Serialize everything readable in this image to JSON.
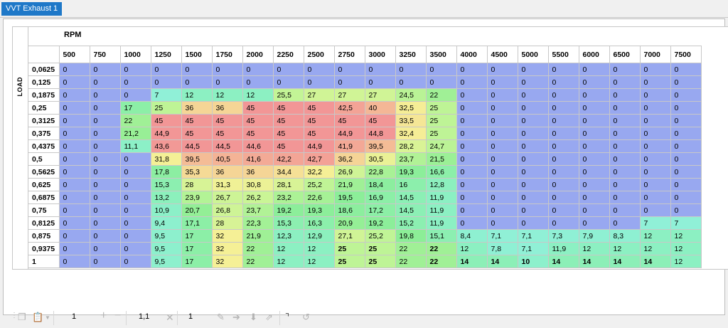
{
  "tab_title": "VVT Exhaust 1",
  "axis": {
    "x_label": "RPM",
    "y_label": "LOAD"
  },
  "rpm": [
    "500",
    "750",
    "1000",
    "1250",
    "1500",
    "1750",
    "2000",
    "2250",
    "2500",
    "2750",
    "3000",
    "3250",
    "3500",
    "4000",
    "4500",
    "5000",
    "5500",
    "6000",
    "6500",
    "7000",
    "7500"
  ],
  "rows": [
    {
      "load": "0,0625",
      "v": [
        "0",
        "0",
        "0",
        "0",
        "0",
        "0",
        "0",
        "0",
        "0",
        "0",
        "0",
        "0",
        "0",
        "0",
        "0",
        "0",
        "0",
        "0",
        "0",
        "0",
        "0"
      ]
    },
    {
      "load": "0,125",
      "v": [
        "0",
        "0",
        "0",
        "0",
        "0",
        "0",
        "0",
        "0",
        "0",
        "0",
        "0",
        "0",
        "0",
        "0",
        "0",
        "0",
        "0",
        "0",
        "0",
        "0",
        "0"
      ]
    },
    {
      "load": "0,1875",
      "v": [
        "0",
        "0",
        "0",
        "7",
        "12",
        "12",
        "12",
        "25,5",
        "27",
        "27",
        "27",
        "24,5",
        "22",
        "0",
        "0",
        "0",
        "0",
        "0",
        "0",
        "0",
        "0"
      ]
    },
    {
      "load": "0,25",
      "v": [
        "0",
        "0",
        "17",
        "25",
        "36",
        "36",
        "45",
        "45",
        "45",
        "42,5",
        "40",
        "32,5",
        "25",
        "0",
        "0",
        "0",
        "0",
        "0",
        "0",
        "0",
        "0"
      ]
    },
    {
      "load": "0,3125",
      "v": [
        "0",
        "0",
        "22",
        "45",
        "45",
        "45",
        "45",
        "45",
        "45",
        "45",
        "45",
        "33,5",
        "25",
        "0",
        "0",
        "0",
        "0",
        "0",
        "0",
        "0",
        "0"
      ]
    },
    {
      "load": "0,375",
      "v": [
        "0",
        "0",
        "21,2",
        "44,9",
        "45",
        "45",
        "45",
        "45",
        "45",
        "44,9",
        "44,8",
        "32,4",
        "25",
        "0",
        "0",
        "0",
        "0",
        "0",
        "0",
        "0",
        "0"
      ]
    },
    {
      "load": "0,4375",
      "v": [
        "0",
        "0",
        "11,1",
        "43,6",
        "44,5",
        "44,5",
        "44,6",
        "45",
        "44,9",
        "41,9",
        "39,5",
        "28,2",
        "24,7",
        "0",
        "0",
        "0",
        "0",
        "0",
        "0",
        "0",
        "0"
      ]
    },
    {
      "load": "0,5",
      "v": [
        "0",
        "0",
        "0",
        "31,8",
        "39,5",
        "40,5",
        "41,6",
        "42,2",
        "42,7",
        "36,2",
        "30,5",
        "23,7",
        "21,5",
        "0",
        "0",
        "0",
        "0",
        "0",
        "0",
        "0",
        "0"
      ]
    },
    {
      "load": "0,5625",
      "v": [
        "0",
        "0",
        "0",
        "17,8",
        "35,3",
        "36",
        "36",
        "34,4",
        "32,2",
        "26,9",
        "22,8",
        "19,3",
        "16,6",
        "0",
        "0",
        "0",
        "0",
        "0",
        "0",
        "0",
        "0"
      ]
    },
    {
      "load": "0,625",
      "v": [
        "0",
        "0",
        "0",
        "15,3",
        "28",
        "31,3",
        "30,8",
        "28,1",
        "25,2",
        "21,9",
        "18,4",
        "16",
        "12,8",
        "0",
        "0",
        "0",
        "0",
        "0",
        "0",
        "0",
        "0"
      ]
    },
    {
      "load": "0,6875",
      "v": [
        "0",
        "0",
        "0",
        "13,2",
        "23,9",
        "26,7",
        "26,2",
        "23,2",
        "22,6",
        "19,5",
        "16,9",
        "14,5",
        "11,9",
        "0",
        "0",
        "0",
        "0",
        "0",
        "0",
        "0",
        "0"
      ]
    },
    {
      "load": "0,75",
      "v": [
        "0",
        "0",
        "0",
        "10,9",
        "20,7",
        "26,8",
        "23,7",
        "19,2",
        "19,3",
        "18,6",
        "17,2",
        "14,5",
        "11,9",
        "0",
        "0",
        "0",
        "0",
        "0",
        "0",
        "0",
        "0"
      ]
    },
    {
      "load": "0,8125",
      "v": [
        "0",
        "0",
        "0",
        "9,4",
        "17,1",
        "28",
        "22,3",
        "15,3",
        "16,3",
        "20,9",
        "19,2",
        "15,2",
        "11,9",
        "0",
        "0",
        "0",
        "0",
        "0",
        "0",
        "7",
        "7"
      ]
    },
    {
      "load": "0,875",
      "v": [
        "0",
        "0",
        "0",
        "9,5",
        "17",
        "32",
        "21,9",
        "12,3",
        "12,9",
        "27,1",
        "25,2",
        "19,8",
        "15,1",
        "8,4",
        "7,1",
        "7,1",
        "7,3",
        "7,9",
        "8,3",
        "12",
        "12"
      ]
    },
    {
      "load": "0,9375",
      "v": [
        "0",
        "0",
        "0",
        "9,5",
        "17",
        "32",
        "22",
        "12",
        "12",
        "25",
        "25",
        "22",
        "22",
        "12",
        "7,8",
        "7,1",
        "11,9",
        "12",
        "12",
        "12",
        "12"
      ]
    },
    {
      "load": "1",
      "v": [
        "0",
        "0",
        "0",
        "9,5",
        "17",
        "32",
        "22",
        "12",
        "12",
        "25",
        "25",
        "22",
        "22",
        "14",
        "14",
        "10",
        "14",
        "14",
        "14",
        "14",
        "12"
      ]
    }
  ],
  "bold_cells": [
    [
      14,
      9
    ],
    [
      14,
      10
    ],
    [
      14,
      12
    ],
    [
      15,
      9
    ],
    [
      15,
      10
    ],
    [
      15,
      12
    ],
    [
      15,
      13
    ],
    [
      15,
      14
    ],
    [
      15,
      15
    ],
    [
      15,
      16
    ],
    [
      15,
      17
    ],
    [
      15,
      18
    ],
    [
      15,
      19
    ]
  ],
  "toolbar": {
    "input1": "1",
    "input2": "1,1",
    "input3": "1"
  },
  "colors": {
    "tab": "#1e78c8"
  }
}
